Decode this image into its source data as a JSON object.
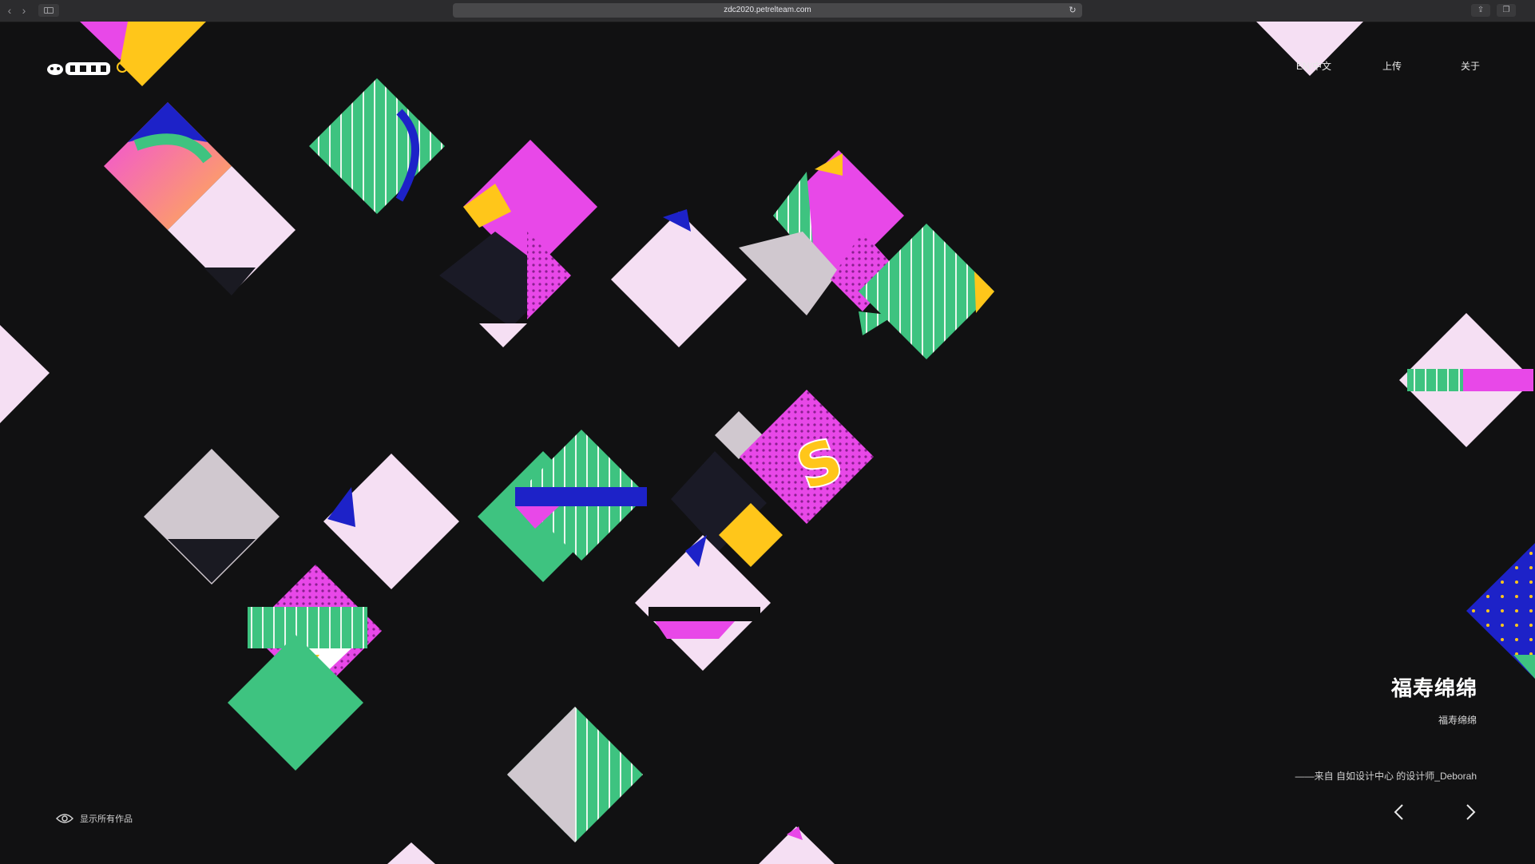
{
  "browser": {
    "url": "zdc2020.petrelteam.com"
  },
  "header": {
    "nav": {
      "lang": "EN/中文",
      "upload": "上传",
      "about": "关于"
    }
  },
  "artwork": {
    "title": "福寿绵绵",
    "subtitle": "福寿绵绵",
    "credit": "——来自 自如设计中心 的设计师_Deborah"
  },
  "footer": {
    "show_all": "显示所有作品"
  },
  "colors": {
    "background": "#111112",
    "pink": "#f5dff3",
    "magenta": "#e848e8",
    "green": "#3ec380",
    "yellow": "#ffc61a",
    "blue": "#1d22c8",
    "grey": "#d0c8cf"
  },
  "icons": {
    "back": "chevron-left-icon",
    "forward": "chevron-right-icon",
    "sidebar": "sidebar-icon",
    "reload": "reload-icon",
    "share": "share-icon",
    "tabs": "tabs-icon",
    "eye": "eye-icon",
    "prev": "chevron-left-icon",
    "next": "chevron-right-icon"
  }
}
